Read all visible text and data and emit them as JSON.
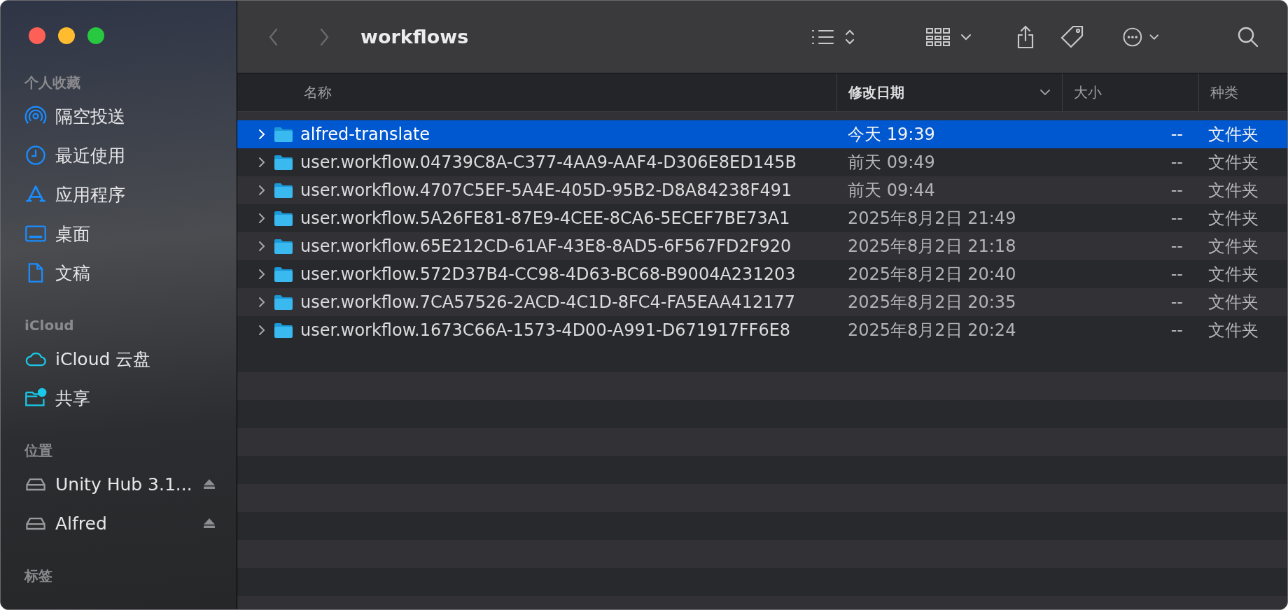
{
  "toolbar": {
    "back": {
      "disabled": true
    },
    "forward": {
      "disabled": true
    },
    "title": "workflows"
  },
  "sidebar": {
    "sections": [
      {
        "heading": "个人收藏",
        "items": [
          {
            "kind": "airdrop",
            "label": "隔空投送"
          },
          {
            "kind": "recent",
            "label": "最近使用"
          },
          {
            "kind": "apps",
            "label": "应用程序"
          },
          {
            "kind": "desktop",
            "label": "桌面"
          },
          {
            "kind": "document",
            "label": "文稿"
          }
        ]
      },
      {
        "heading": "iCloud",
        "items": [
          {
            "kind": "cloud",
            "label": "iCloud 云盘"
          },
          {
            "kind": "shared",
            "label": "共享"
          }
        ]
      },
      {
        "heading": "位置",
        "items": [
          {
            "kind": "drive",
            "label": "Unity Hub 3.1...",
            "ejectable": true
          },
          {
            "kind": "drive",
            "label": "Alfred",
            "ejectable": true
          }
        ]
      },
      {
        "heading": "标签"
      }
    ]
  },
  "table": {
    "columns": [
      {
        "label": "名称",
        "sorted": false
      },
      {
        "label": "修改日期",
        "sorted": true
      },
      {
        "label": "大小",
        "sorted": false
      },
      {
        "label": "种类",
        "sorted": false
      }
    ],
    "rows": [
      {
        "name": "alfred-translate",
        "modified": "今天 19:39",
        "size": "--",
        "kind": "文件夹",
        "selected": true,
        "expanded": false
      },
      {
        "name": "user.workflow.04739C8A-C377-4AA9-AAF4-D306E8ED145B",
        "modified": "前天 09:49",
        "size": "--",
        "kind": "文件夹",
        "selected": false,
        "expanded": false
      },
      {
        "name": "user.workflow.4707C5EF-5A4E-405D-95B2-D8A84238F491",
        "modified": "前天 09:44",
        "size": "--",
        "kind": "文件夹",
        "selected": false,
        "expanded": false
      },
      {
        "name": "user.workflow.5A26FE81-87E9-4CEE-8CA6-5ECEF7BE73A1",
        "modified": "2025年8月2日 21:49",
        "size": "--",
        "kind": "文件夹",
        "selected": false,
        "expanded": false
      },
      {
        "name": "user.workflow.65E212CD-61AF-43E8-8AD5-6F567FD2F920",
        "modified": "2025年8月2日 21:18",
        "size": "--",
        "kind": "文件夹",
        "selected": false,
        "expanded": false
      },
      {
        "name": "user.workflow.572D37B4-CC98-4D63-BC68-B9004A231203",
        "modified": "2025年8月2日 20:40",
        "size": "--",
        "kind": "文件夹",
        "selected": false,
        "expanded": false
      },
      {
        "name": "user.workflow.7CA57526-2ACD-4C1D-8FC4-FA5EAA412177",
        "modified": "2025年8月2日 20:35",
        "size": "--",
        "kind": "文件夹",
        "selected": false,
        "expanded": false
      },
      {
        "name": "user.workflow.1673C66A-1573-4D00-A991-D671917FF6E8",
        "modified": "2025年8月2日 20:24",
        "size": "--",
        "kind": "文件夹",
        "selected": false,
        "expanded": false
      }
    ]
  }
}
